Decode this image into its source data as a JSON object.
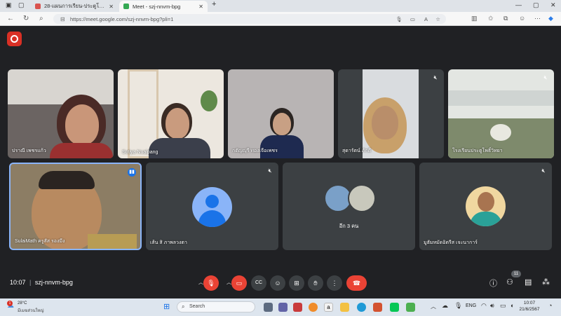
{
  "browser": {
    "tabs": [
      {
        "title": "28-แผนการเรียน-ประตูโพธิ์ทองา(1)",
        "active": false
      },
      {
        "title": "Meet - szj-nnvm-bpg",
        "active": true
      }
    ],
    "new_tab": "+",
    "url": "https://meet.google.com/szj-nnvm-bpg?pli=1"
  },
  "meet": {
    "participants_top": [
      {
        "name": "ปราณี เพชรแก้ว",
        "muted": false
      },
      {
        "name": "Sutiya Nualpang",
        "muted": false
      },
      {
        "name": "กตัญญุรี ทองเจือเพชร",
        "muted": false
      },
      {
        "name": "สุดารัตน์ ภักดี",
        "muted": true
      },
      {
        "name": "โรงเรียนประตูโพธิ์วิทยา",
        "muted": true
      }
    ],
    "participants_bottom": [
      {
        "name": "SulaiMath ครูสัส รองมีง",
        "speaking": true
      },
      {
        "name": "เส้น สิ ภาพลวงตา",
        "muted": true
      },
      {
        "name": "อีก 3 คน",
        "muted": false
      },
      {
        "name": "มูฮัมหมัดอิตรีส เจะนาการ์",
        "muted": true
      }
    ],
    "time": "10:07",
    "separator": "|",
    "meeting_code": "szj-nnvm-bpg",
    "participant_count": "11"
  },
  "taskbar": {
    "weather_temp": "28°C",
    "weather_text": "มีเมฆส่วนใหญ่",
    "weather_badge": "1",
    "search_placeholder": "Search",
    "lang": "ENG",
    "clock_time": "10:07",
    "clock_date": "21/6/2567"
  },
  "colors": {
    "accent_blue": "#8ab4f8",
    "danger": "#ea4335",
    "meet_bg": "#202124",
    "tile_bg": "#3c4043"
  }
}
